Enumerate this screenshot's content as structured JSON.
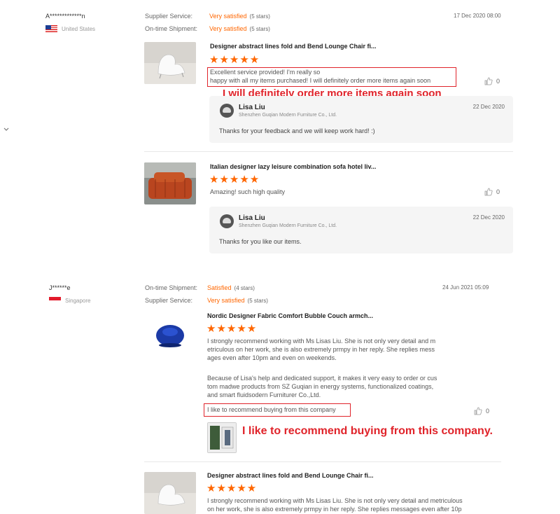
{
  "reviews": [
    {
      "user": "A*************n",
      "country": "United States",
      "ratings": [
        {
          "label": "Supplier Service:",
          "value": "Very satisfied",
          "stars": "(5 stars)"
        },
        {
          "label": "On-time Shipment:",
          "value": "Very satisfied",
          "stars": "(5 stars)"
        }
      ],
      "date": "17 Dec 2020 08:00",
      "products": [
        {
          "title": "Designer abstract lines fold and Bend Lounge Chair fi...",
          "stars": "★★★★★",
          "text_lines": [
            "Excellent service provided! I'm really so",
            "happy with all my items purchased! I will definitely order more items again soon"
          ],
          "overlay": "I will definitely order more items again soon",
          "likes": "0",
          "reply": {
            "name": "Lisa Liu",
            "company": "Shenzhen Guqian Modern Furniture Co., Ltd.",
            "date": "22 Dec 2020",
            "message": "Thanks for your feedback and we will keep work hard! :)"
          }
        },
        {
          "title": "Italian designer lazy leisure combination sofa hotel liv...",
          "stars": "★★★★★",
          "text_lines": [
            "Amazing! such high quality"
          ],
          "likes": "0",
          "reply": {
            "name": "Lisa Liu",
            "company": "Shenzhen Guqian Modern Furniture Co., Ltd.",
            "date": "22 Dec 2020",
            "message": "Thanks for you like our items."
          }
        }
      ]
    },
    {
      "user": "J******e",
      "country": "Singapore",
      "ratings": [
        {
          "label": "On-time Shipment:",
          "value": "Satisfied",
          "stars": "(4 stars)"
        },
        {
          "label": "Supplier Service:",
          "value": "Very satisfied",
          "stars": "(5 stars)"
        }
      ],
      "date": "24 Jun 2021 05:09",
      "products": [
        {
          "title": "Nordic Designer Fabric Comfort Bubble Couch armch...",
          "stars": "★★★★★",
          "text_lines": [
            "I strongly recommend working with Ms Lisas Liu. She is not only very detail and m",
            "etriculous on her work, she is also extremely prmpy in her reply. She replies mess",
            "ages even after 10pm and even on weekends."
          ],
          "text2_lines": [
            "Because of Lisa's help and dedicated support, it makes it very easy to order or cus",
            "tom madwe products from SZ Guqian in energy systems, functionalized coatings,",
            "and smart fluidsodern Furniturer Co.,Ltd."
          ],
          "boxed": "I like to recommend buying from this company",
          "overlay": "I like to recommend buying from this company.",
          "likes": "0"
        },
        {
          "title": "Designer abstract lines fold and Bend Lounge Chair fi...",
          "stars": "★★★★★",
          "text_lines": [
            "I strongly recommend working with Ms Lisas Liu. She is not only very detail and metriculous",
            "on her work, she is also extremely prmpy in her reply. She replies messages even after 10p"
          ]
        }
      ]
    }
  ],
  "side_icon": "chevron-down-icon",
  "like_icon": "thumbs-up-icon",
  "colors": {
    "accent": "#ff6600",
    "highlight": "#e0232a",
    "reply_bg": "#f5f5f5"
  }
}
